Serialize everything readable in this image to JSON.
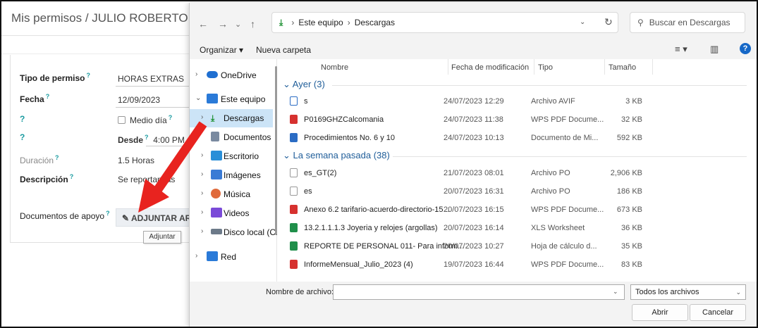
{
  "background_app": {
    "title": "Mis permisos / JULIO ROBERTO RAMI",
    "fields": {
      "tipo_label": "Tipo de permiso",
      "tipo_value": "HORAS EXTRAS",
      "fecha_label": "Fecha",
      "fecha_value": "12/09/2023",
      "q1": "?",
      "medio_dia": "Medio día",
      "q2": "?",
      "desde_label": "Desde",
      "desde_value": "4:00 PM",
      "duracion_label": "Duración",
      "duracion_value": "1.5 Horas",
      "descripcion_label": "Descripción",
      "descripcion_value": "Se reportan    las",
      "documentos_label": "Documentos de apoyo"
    },
    "help_marker": "?",
    "attach_button": "ADJUNTAR ARCH",
    "tooltip": "Adjuntar"
  },
  "dialog": {
    "nav_buttons": [
      "←",
      "→",
      "⌄",
      "↑"
    ],
    "breadcrumb": [
      "Este equipo",
      "Descargas"
    ],
    "search_placeholder": "Buscar en Descargas",
    "toolbar": {
      "organizar": "Organizar ▾",
      "nueva_carpeta": "Nueva carpeta"
    },
    "nav_items": [
      {
        "label": "OneDrive",
        "icon": "onedrive-cloud-icon",
        "color": "#1f6fd1"
      },
      {
        "label": "Este equipo",
        "icon": "computer-icon",
        "color": "#2a7ad8"
      },
      {
        "label": "Descargas",
        "icon": "download-icon",
        "color": "#1a8f2f",
        "selected": true
      },
      {
        "label": "Documentos",
        "icon": "documents-icon",
        "color": "#7a8aa0"
      },
      {
        "label": "Escritorio",
        "icon": "desktop-icon",
        "color": "#2a8fd8"
      },
      {
        "label": "Imágenes",
        "icon": "pictures-icon",
        "color": "#3a7bd5"
      },
      {
        "label": "Música",
        "icon": "music-icon",
        "color": "#e06a3b"
      },
      {
        "label": "Videos",
        "icon": "videos-icon",
        "color": "#7a4ad8"
      },
      {
        "label": "Disco local (C:)",
        "icon": "drive-icon",
        "color": "#6c7a89"
      },
      {
        "label": "Red",
        "icon": "network-icon",
        "color": "#2a7ad8"
      }
    ],
    "columns": {
      "name": "Nombre",
      "date": "Fecha de modificación",
      "type": "Tipo",
      "size": "Tamaño"
    },
    "groups": [
      {
        "title": "Ayer (3)",
        "files": [
          {
            "name": "s",
            "date": "24/07/2023 12:29",
            "type": "Archivo AVIF",
            "size": "3 KB",
            "kind": "avif"
          },
          {
            "name": "P0169GHZCalcomania",
            "date": "24/07/2023 11:38",
            "type": "WPS PDF Docume...",
            "size": "32 KB",
            "kind": "pdf"
          },
          {
            "name": "Procedimientos No. 6 y 10",
            "date": "24/07/2023 10:13",
            "type": "Documento de Mi...",
            "size": "592 KB",
            "kind": "doc"
          }
        ]
      },
      {
        "title": "La semana pasada (38)",
        "files": [
          {
            "name": "es_GT(2)",
            "date": "21/07/2023 08:01",
            "type": "Archivo PO",
            "size": "2,906 KB",
            "kind": "blank"
          },
          {
            "name": "es",
            "date": "20/07/2023 16:31",
            "type": "Archivo PO",
            "size": "186 KB",
            "kind": "blank"
          },
          {
            "name": "Anexo 6.2 tarifario-acuerdo-directorio-15...",
            "date": "20/07/2023 16:15",
            "type": "WPS PDF Docume...",
            "size": "673 KB",
            "kind": "pdf"
          },
          {
            "name": "13.2.1.1.1.3 Joyeria y relojes  (argollas)",
            "date": "20/07/2023 16:14",
            "type": "XLS Worksheet",
            "size": "36 KB",
            "kind": "xls"
          },
          {
            "name": "REPORTE DE PERSONAL 011- Para inform...",
            "date": "20/07/2023 10:27",
            "type": "Hoja de cálculo d...",
            "size": "35 KB",
            "kind": "xls"
          },
          {
            "name": "InformeMensual_Julio_2023 (4)",
            "date": "19/07/2023 16:44",
            "type": "WPS PDF Docume...",
            "size": "83 KB",
            "kind": "pdf"
          }
        ]
      }
    ],
    "filename_label": "Nombre de archivo:",
    "filename_value": "",
    "filter_value": "Todos los archivos",
    "open_button": "Abrir",
    "cancel_button": "Cancelar"
  },
  "annotation": {
    "arrow_color": "#e8231f"
  }
}
